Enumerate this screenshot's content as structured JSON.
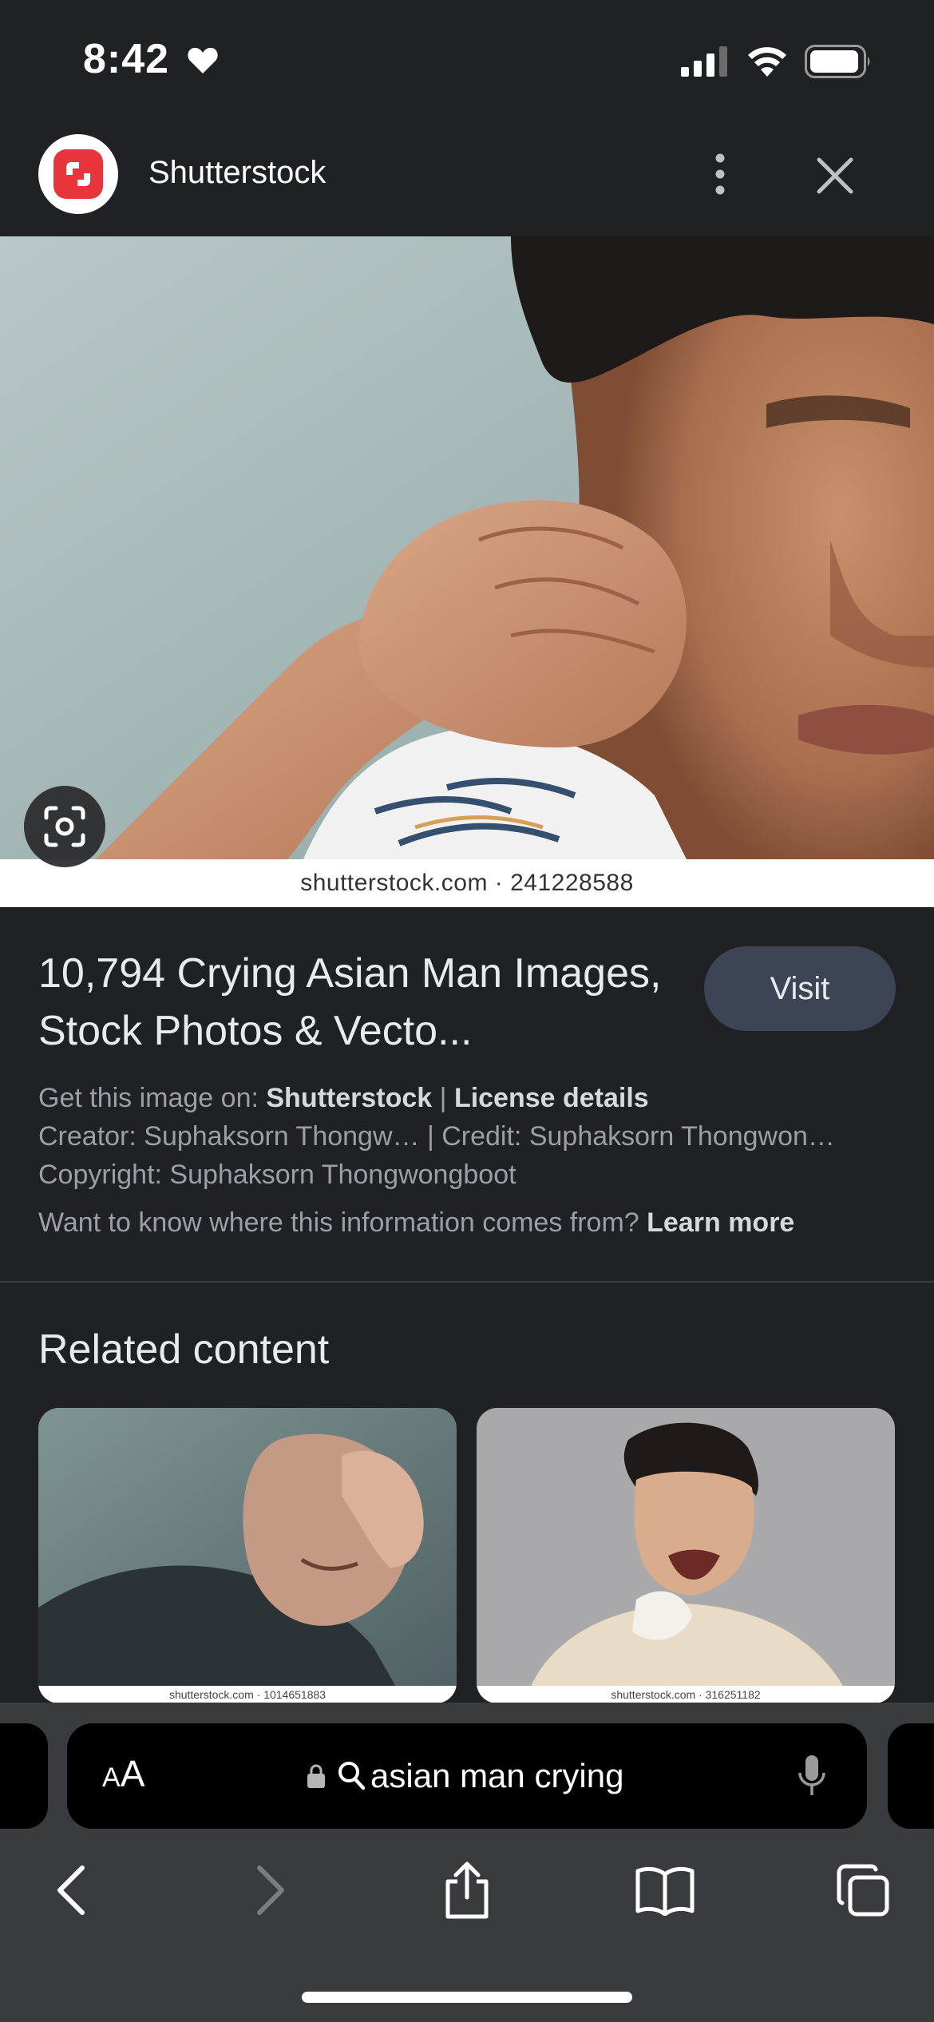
{
  "status_bar": {
    "time": "8:42",
    "icons": [
      "heart-icon",
      "signal-icon",
      "wifi-icon",
      "battery-icon"
    ]
  },
  "header": {
    "site_name": "Shutterstock",
    "logo_color": "#e8343b",
    "icons": [
      "more-vertical-icon",
      "close-icon"
    ]
  },
  "image": {
    "watermark": "shutterstock.com · 241228588",
    "lens_icon": "google-lens-icon"
  },
  "result": {
    "title": "10,794 Crying Asian Man Images, Stock Photos & Vecto...",
    "visit_label": "Visit",
    "get_image_prefix": "Get this image on: ",
    "get_image_site": "Shutterstock",
    "separator": " | ",
    "license_label": "License details",
    "creator_line": "Creator: Suphaksorn Thongw… | Credit: Suphaksorn Thongwon…",
    "copyright_line": "Copyright: Suphaksorn Thongwongboot",
    "info_question": "Want to know where this information comes from? ",
    "learn_more": "Learn more"
  },
  "related": {
    "heading": "Related content",
    "cards": [
      {
        "watermark": "shutterstock.com · 1014651883"
      },
      {
        "watermark": "shutterstock.com · 316251182"
      }
    ]
  },
  "browser": {
    "aa_label_large": "A",
    "aa_label_small": "A",
    "address_text": "asian man crying",
    "accent": "#3c4455"
  }
}
